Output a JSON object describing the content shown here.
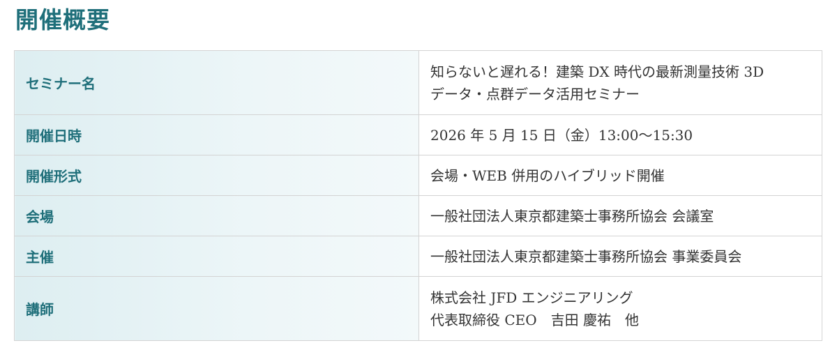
{
  "page_title": "開催概要",
  "rows": [
    {
      "label": "セミナー名",
      "lines": [
        "知らないと遅れる！建築 DX 時代の最新測量技術 3D",
        "データ・点群データ活用セミナー"
      ]
    },
    {
      "label": "開催日時",
      "lines": [
        "2026 年 5 月 15 日（金）13:00〜15:30"
      ]
    },
    {
      "label": "開催形式",
      "lines": [
        "会場・WEB 併用のハイブリッド開催"
      ]
    },
    {
      "label": "会場",
      "lines": [
        "一般社団法人東京都建築士事務所協会 会議室"
      ]
    },
    {
      "label": "主催",
      "lines": [
        "一般社団法人東京都建築士事務所協会 事業委員会"
      ]
    },
    {
      "label": "講師",
      "lines": [
        "株式会社 JFD エンジニアリング",
        "代表取締役 CEO　吉田 慶祐　他"
      ]
    }
  ]
}
